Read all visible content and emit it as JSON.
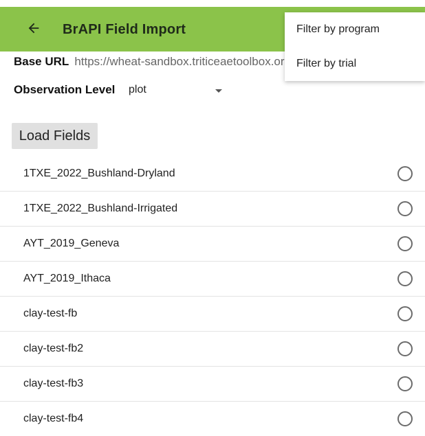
{
  "appbar": {
    "title": "BrAPI Field Import",
    "back_icon": "arrow-left-icon",
    "color": "#8bc34a"
  },
  "menu": {
    "items": [
      {
        "label": "Filter by program"
      },
      {
        "label": "Filter by trial"
      }
    ]
  },
  "settings": {
    "base_url_label": "Base URL",
    "base_url_value": "https://wheat-sandbox.triticeaetoolbox.org",
    "observation_level_label": "Observation Level",
    "observation_level_value": "plot"
  },
  "load_button": {
    "label": "Load Fields"
  },
  "fields": [
    {
      "name": "1TXE_2022_Bushland-Dryland",
      "selected": false
    },
    {
      "name": "1TXE_2022_Bushland-Irrigated",
      "selected": false
    },
    {
      "name": "AYT_2019_Geneva",
      "selected": false
    },
    {
      "name": "AYT_2019_Ithaca",
      "selected": false
    },
    {
      "name": "clay-test-fb",
      "selected": false
    },
    {
      "name": "clay-test-fb2",
      "selected": false
    },
    {
      "name": "clay-test-fb3",
      "selected": false
    },
    {
      "name": "clay-test-fb4",
      "selected": false
    }
  ]
}
